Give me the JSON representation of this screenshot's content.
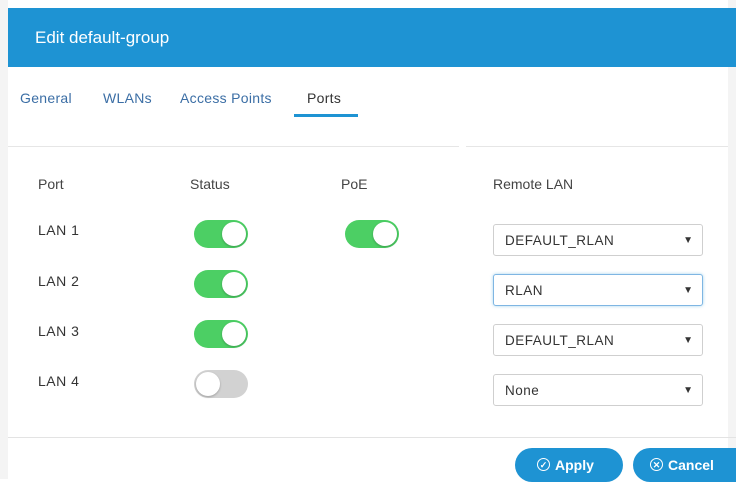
{
  "dialog": {
    "title": "Edit default-group"
  },
  "tabs": [
    {
      "label": "General",
      "active": false
    },
    {
      "label": "WLANs",
      "active": false
    },
    {
      "label": "Access Points",
      "active": false
    },
    {
      "label": "Ports",
      "active": true
    }
  ],
  "table": {
    "headers": {
      "port": "Port",
      "status": "Status",
      "poe": "PoE",
      "remote_lan": "Remote LAN"
    },
    "rows": [
      {
        "port": "LAN 1",
        "status": "on",
        "poe": "on",
        "remote_lan": "DEFAULT_RLAN"
      },
      {
        "port": "LAN 2",
        "status": "on",
        "poe": null,
        "remote_lan": "RLAN"
      },
      {
        "port": "LAN 3",
        "status": "on",
        "poe": null,
        "remote_lan": "DEFAULT_RLAN"
      },
      {
        "port": "LAN 4",
        "status": "off",
        "poe": null,
        "remote_lan": "None"
      }
    ]
  },
  "buttons": {
    "apply": "Apply",
    "cancel": "Cancel"
  },
  "icons": {
    "select_arrow": "▼",
    "apply_icon": "check-circle-icon",
    "cancel_icon": "x-circle-icon"
  },
  "colors": {
    "header": "#1e93d3",
    "toggle_on": "#4ccf64",
    "toggle_off": "#d2d2d2",
    "button": "#1e93d3"
  }
}
